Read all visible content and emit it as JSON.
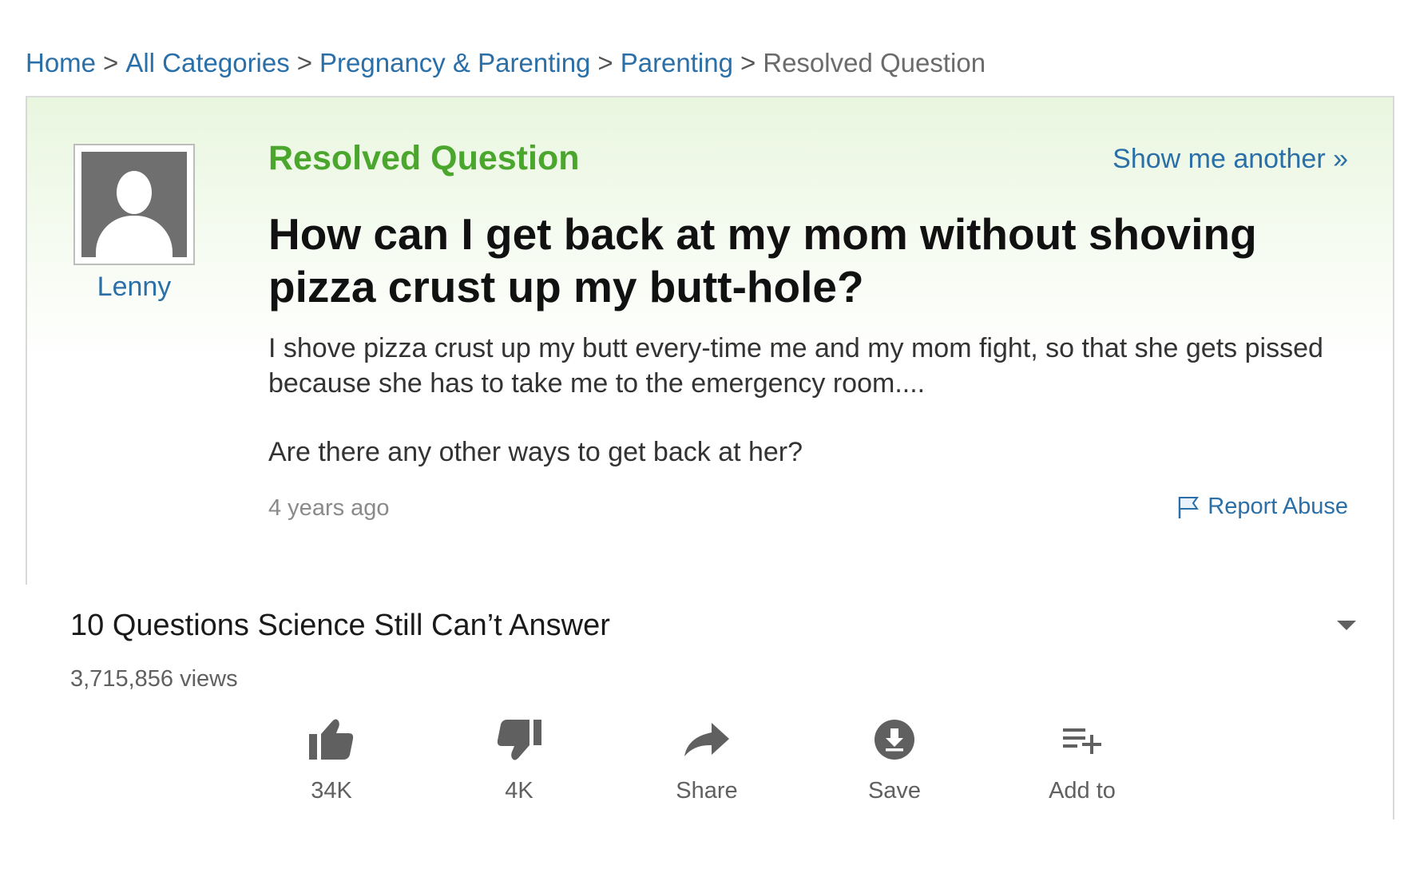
{
  "breadcrumb": {
    "items": [
      "Home",
      "All Categories",
      "Pregnancy & Parenting",
      "Parenting"
    ],
    "separator": ">",
    "current": "Resolved Question"
  },
  "question": {
    "status_label": "Resolved Question",
    "show_another": "Show me another »",
    "author": "Lenny",
    "title": "How can I get back at my mom without shoving pizza crust up my butt-hole?",
    "body_paragraph_1": "I shove pizza crust up my butt every-time me and my mom fight, so that she gets pissed because she has to take me to the emergency room....",
    "body_paragraph_2": "Are there any other ways to get back at her?",
    "timestamp": "4 years ago",
    "report_label": "Report Abuse",
    "colors": {
      "status_green": "#4aa62c",
      "link_blue": "#2a6fa8"
    }
  },
  "video": {
    "title": "10 Questions Science Still Can’t Answer",
    "views": "3,715,856 views",
    "actions": {
      "like": {
        "label": "34K",
        "icon": "thumb-up-icon"
      },
      "dislike": {
        "label": "4K",
        "icon": "thumb-down-icon"
      },
      "share": {
        "label": "Share",
        "icon": "share-arrow-icon"
      },
      "save": {
        "label": "Save",
        "icon": "download-circle-icon"
      },
      "add_to": {
        "label": "Add to",
        "icon": "playlist-add-icon"
      }
    }
  }
}
